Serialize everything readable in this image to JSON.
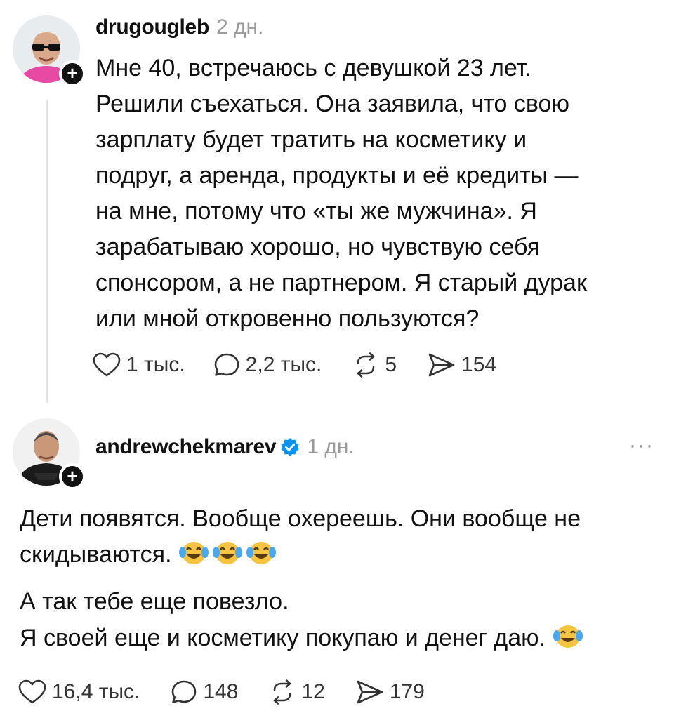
{
  "post1": {
    "username": "drugougleb",
    "time": "2 дн.",
    "text": "Мне 40, встречаюсь с девушкой 23 лет.\nРешили съехаться. Она заявила, что свою\nзарплату будет тратить на косметику и\nподруг, а аренда, продукты и её кредиты —\nна мне, потому что «ты же мужчина». Я\nзарабатываю хорошо, но чувствую себя\nспонсором, а не партнером. Я старый дурак\nили мной откровенно пользуются?",
    "likes": "1 тыс.",
    "replies": "2,2 тыс.",
    "reposts": "5",
    "shares": "154"
  },
  "post2": {
    "username": "andrewchekmarev",
    "time": "1 дн.",
    "more": "···",
    "para1": "Дети появятся. Вообще охереешь. Они вообще не\nскидываются.",
    "para2": "А так тебе еще повезло.",
    "para3": "Я своей еще и косметику покупаю и денег даю.",
    "likes": "16,4 тыс.",
    "replies": "148",
    "reposts": "12",
    "shares": "179"
  },
  "icons": {
    "like": "heart-icon",
    "reply": "speech-bubble-icon",
    "repost": "repost-icon",
    "share": "send-icon",
    "follow": "plus-icon",
    "verified": "verified-badge-icon",
    "emoji": "tears-of-joy-emoji"
  },
  "colors": {
    "text": "#111111",
    "muted": "#9a9a9a",
    "verified": "#0095f6",
    "emoji": "#f5c542"
  }
}
